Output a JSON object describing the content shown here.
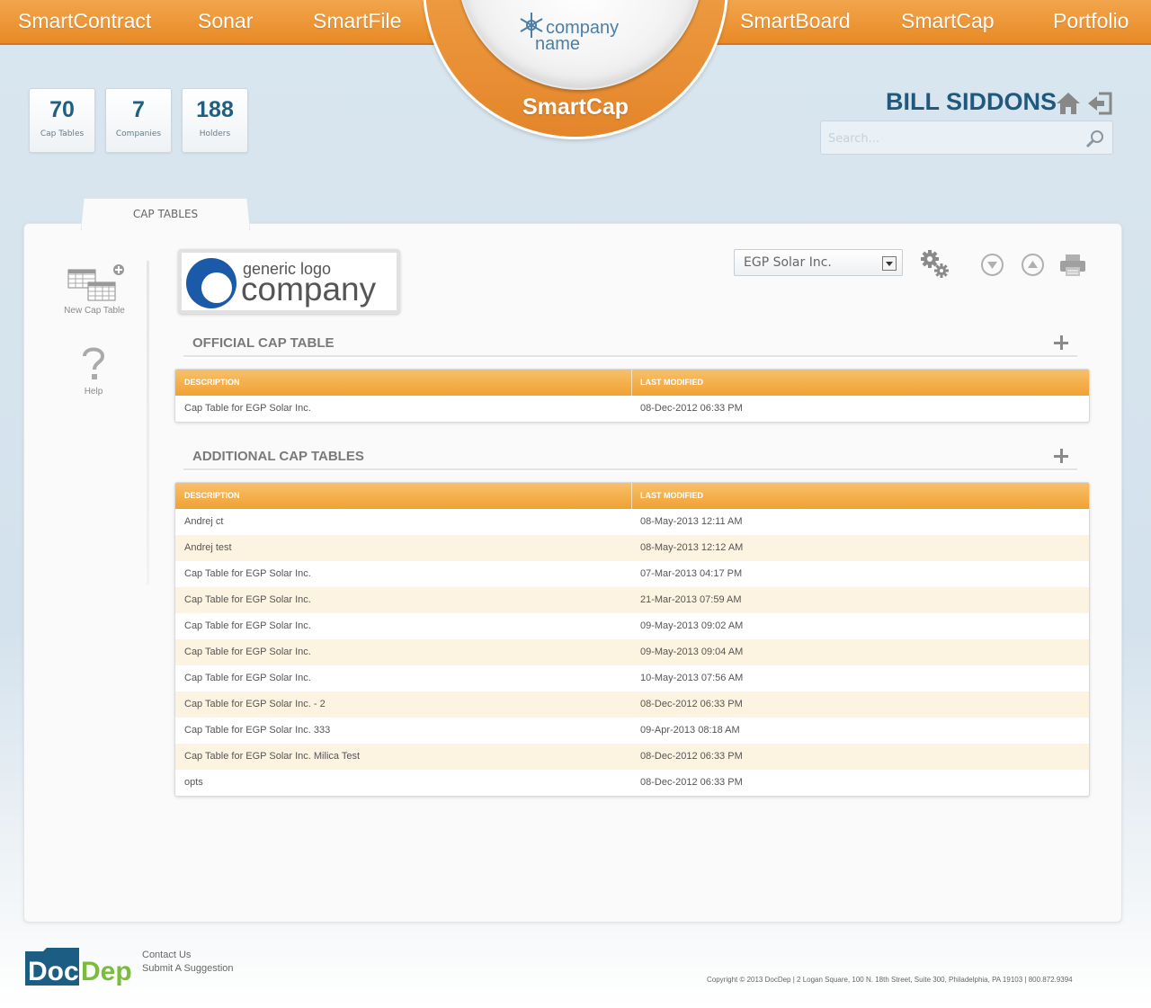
{
  "nav": {
    "left": [
      "SmartContract",
      "Sonar",
      "SmartFile"
    ],
    "right": [
      "SmartBoard",
      "SmartCap",
      "Portfolio"
    ],
    "brand_line1": "company",
    "brand_line2": "name",
    "current_app": "SmartCap"
  },
  "stats": [
    {
      "value": "70",
      "label": "Cap Tables"
    },
    {
      "value": "7",
      "label": "Companies"
    },
    {
      "value": "188",
      "label": "Holders"
    }
  ],
  "user": {
    "name": "BILL SIDDONS",
    "search_placeholder": "Search..."
  },
  "tabs": {
    "active": "CAP TABLES"
  },
  "sidebar": {
    "new_cap_table": "New Cap Table",
    "help": "Help"
  },
  "company_logo": {
    "line1": "generic logo",
    "line2": "company"
  },
  "company_select": {
    "selected": "EGP Solar Inc."
  },
  "official": {
    "title": "OFFICIAL CAP TABLE",
    "columns": [
      "DESCRIPTION",
      "LAST MODIFIED"
    ],
    "rows": [
      {
        "description": "Cap Table for EGP Solar Inc.",
        "modified": "08-Dec-2012 06:33 PM"
      }
    ]
  },
  "additional": {
    "title": "ADDITIONAL CAP TABLES",
    "columns": [
      "DESCRIPTION",
      "LAST MODIFIED"
    ],
    "rows": [
      {
        "description": "Andrej ct",
        "modified": "08-May-2013 12:11 AM"
      },
      {
        "description": "Andrej test",
        "modified": "08-May-2013 12:12 AM"
      },
      {
        "description": "Cap Table for EGP Solar Inc.",
        "modified": "07-Mar-2013 04:17 PM"
      },
      {
        "description": "Cap Table for EGP Solar Inc.",
        "modified": "21-Mar-2013 07:59 AM"
      },
      {
        "description": "Cap Table for EGP Solar Inc.",
        "modified": "09-May-2013 09:02 AM"
      },
      {
        "description": "Cap Table for EGP Solar Inc.",
        "modified": "09-May-2013 09:04 AM"
      },
      {
        "description": "Cap Table for EGP Solar Inc.",
        "modified": "10-May-2013 07:56 AM"
      },
      {
        "description": "Cap Table for EGP Solar Inc. - 2",
        "modified": "08-Dec-2012 06:33 PM"
      },
      {
        "description": "Cap Table for EGP Solar Inc. 333",
        "modified": "09-Apr-2013 08:18 AM"
      },
      {
        "description": "Cap Table for EGP Solar Inc. Milica Test",
        "modified": "08-Dec-2012 06:33 PM"
      },
      {
        "description": "opts",
        "modified": "08-Dec-2012 06:33 PM"
      }
    ]
  },
  "footer": {
    "brand_doc": "Doc",
    "brand_dep": "Dep",
    "contact": "Contact Us",
    "suggestion": "Submit A Suggestion",
    "copyright": "Copyright © 2013 DocDep | 2 Logan Square, 100 N. 18th Street, Suite 300, Philadelphia, PA 19103 | 800.872.9394"
  },
  "colors": {
    "accent_orange": "#ee9a3a",
    "header_blue": "#1f5a7e",
    "row_alt": "#fdf3e1"
  }
}
